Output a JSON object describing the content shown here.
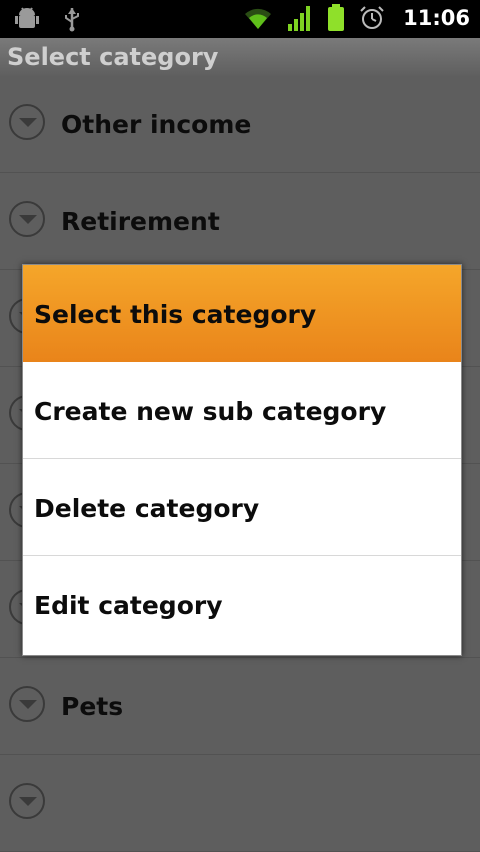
{
  "status_bar": {
    "time": "11:06",
    "icons": [
      "android-debug-icon",
      "usb-icon",
      "wifi-icon",
      "signal-icon",
      "battery-icon",
      "alarm-icon"
    ]
  },
  "title_bar": {
    "title": "Select category"
  },
  "list": {
    "items": [
      {
        "label": "Other income"
      },
      {
        "label": "Retirement"
      },
      {
        "label": ""
      },
      {
        "label": ""
      },
      {
        "label": ""
      },
      {
        "label": ""
      },
      {
        "label": "Pets"
      },
      {
        "label": ""
      }
    ]
  },
  "context_menu": {
    "items": [
      {
        "label": "Select this category"
      },
      {
        "label": "Create new sub category"
      },
      {
        "label": "Delete category"
      },
      {
        "label": "Edit category"
      }
    ],
    "highlight_color": "#f29a22"
  }
}
